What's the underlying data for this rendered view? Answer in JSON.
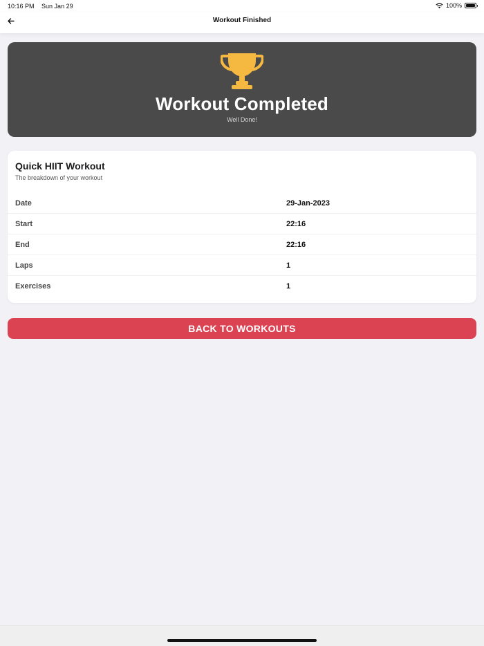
{
  "status_bar": {
    "time": "10:16 PM",
    "date": "Sun Jan 29",
    "battery": "100%",
    "icons": [
      "wifi-icon",
      "battery-icon"
    ]
  },
  "nav": {
    "title": "Workout Finished",
    "back_icon": "arrow-left-icon"
  },
  "hero": {
    "icon": "trophy-icon",
    "icon_color": "#f5b942",
    "title": "Workout Completed",
    "subtitle": "Well Done!",
    "background": "#4a4a4a"
  },
  "details": {
    "title": "Quick HIIT Workout",
    "subtitle": "The breakdown of your workout",
    "rows": [
      {
        "label": "Date",
        "value": "29-Jan-2023"
      },
      {
        "label": "Start",
        "value": "22:16"
      },
      {
        "label": "End",
        "value": "22:16"
      },
      {
        "label": "Laps",
        "value": "1"
      },
      {
        "label": "Exercises",
        "value": "1"
      }
    ]
  },
  "actions": {
    "back_to_workouts": "BACK TO WORKOUTS",
    "button_color": "#dc4352"
  }
}
